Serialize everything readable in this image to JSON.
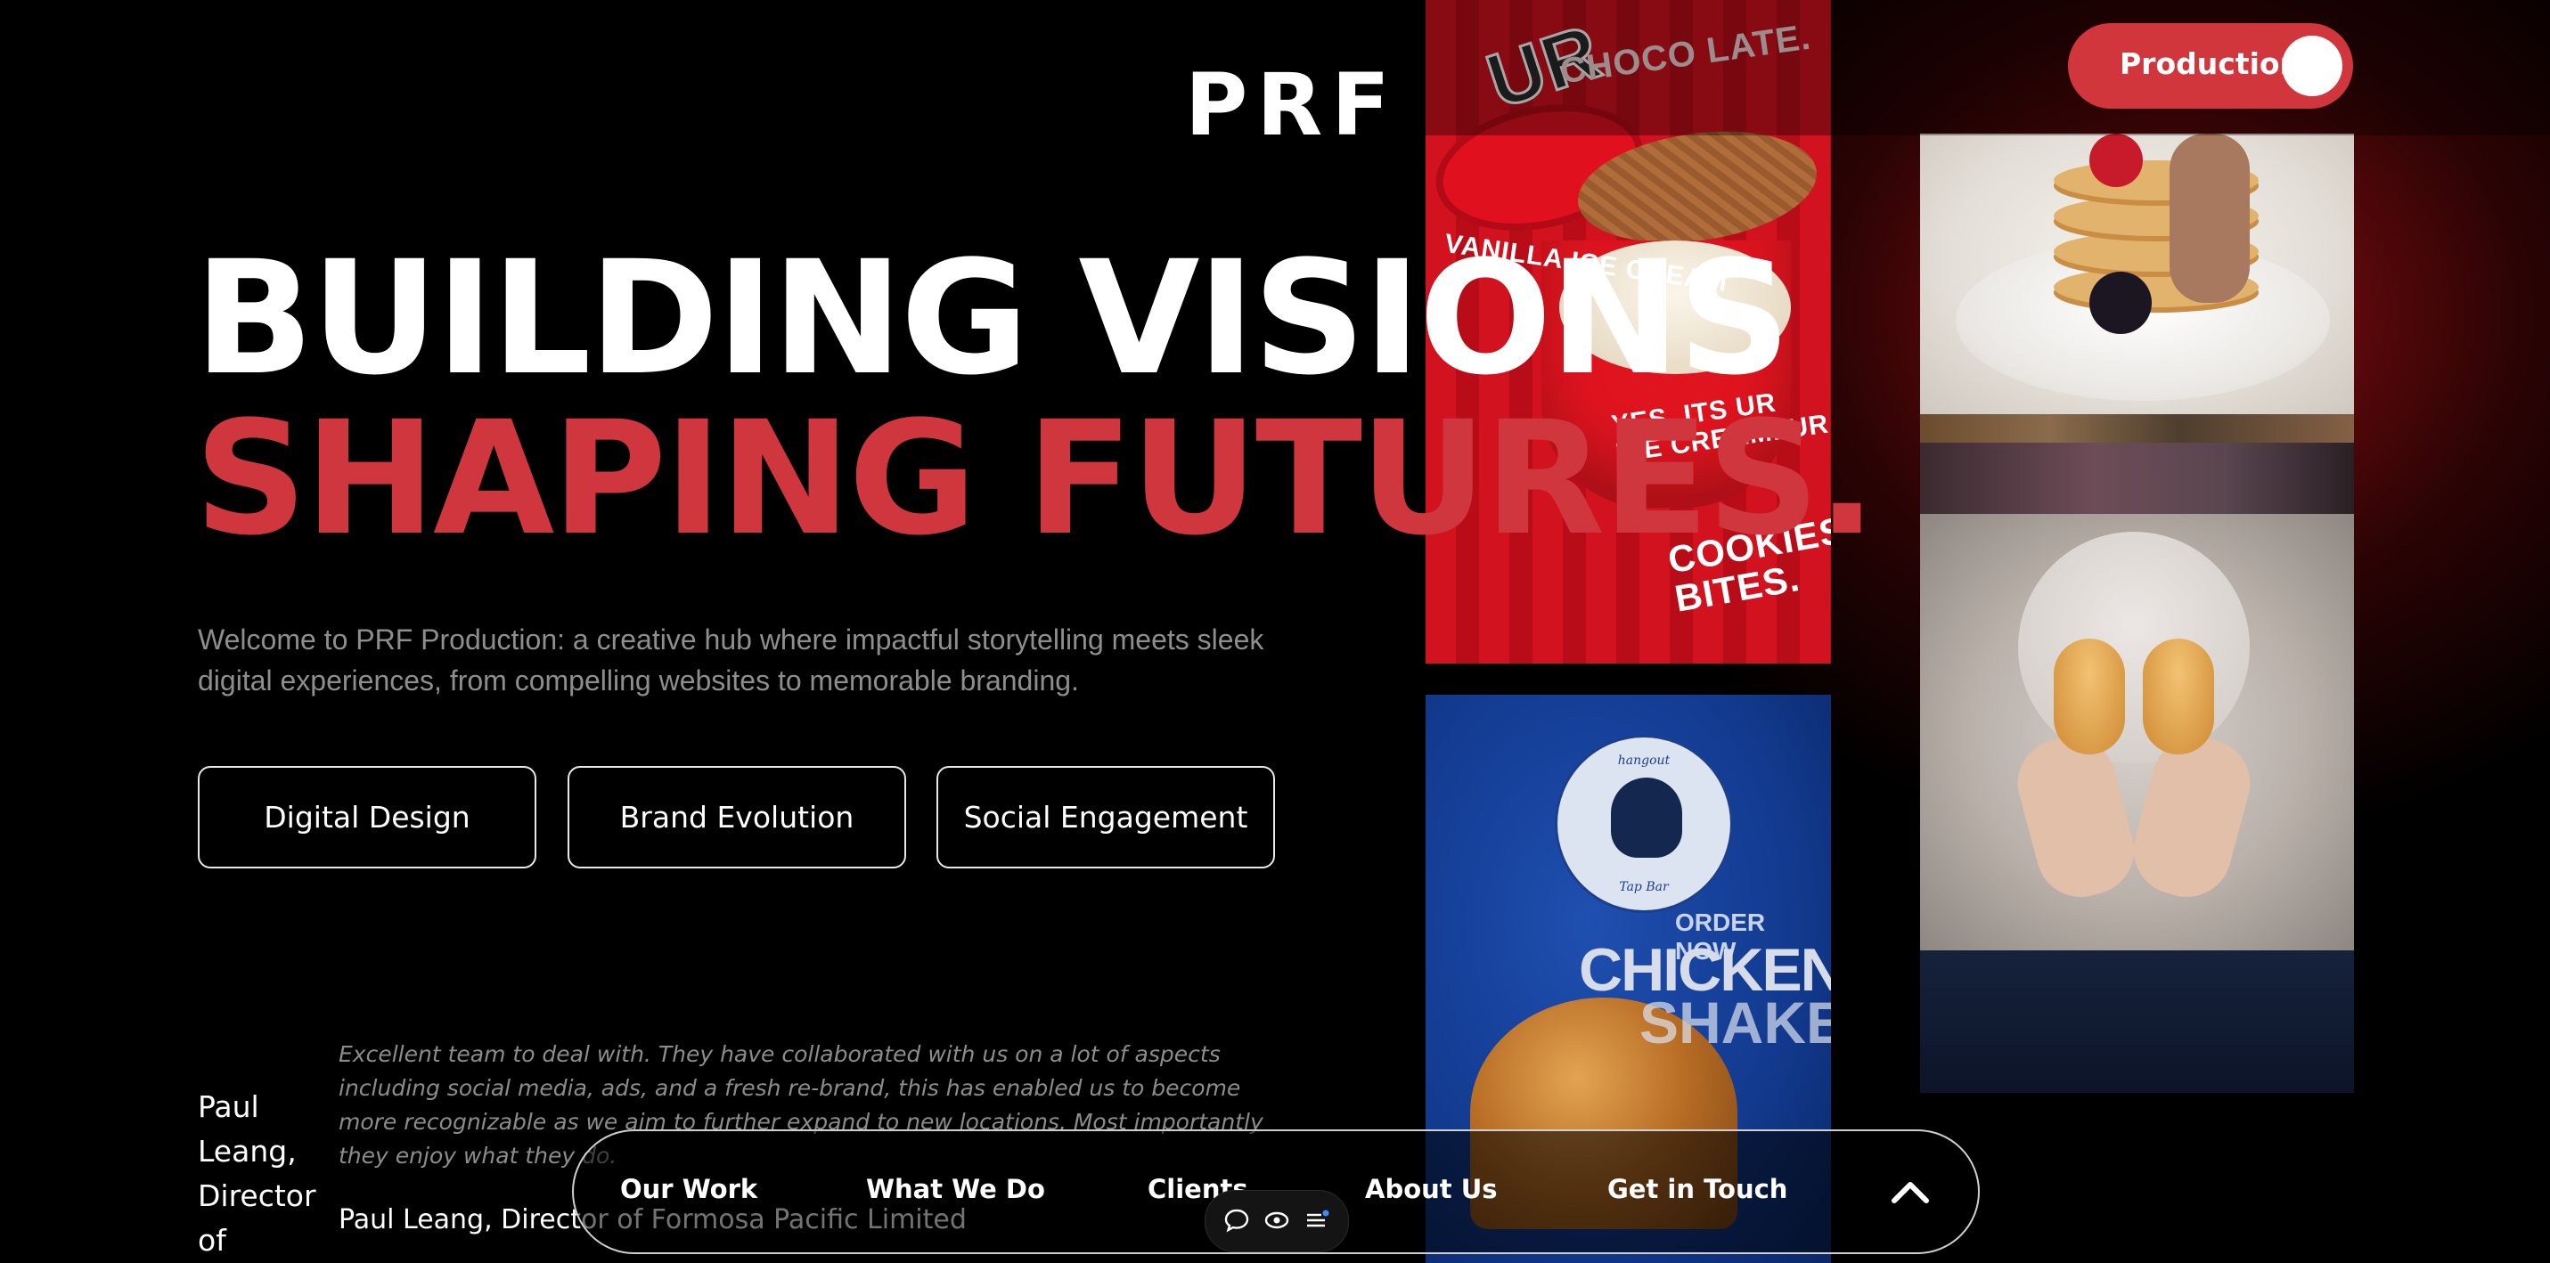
{
  "header": {
    "logo": "PRF",
    "toggle_label": "Production"
  },
  "hero": {
    "line1": "BUILDING VISIONS",
    "line2": "SHAPING FUTURES.",
    "intro": "Welcome to PRF Production: a creative hub where impactful storytelling meets sleek digital experiences, from compelling websites to memorable branding.",
    "services": [
      "Digital Design",
      "Brand Evolution",
      "Social Engagement"
    ]
  },
  "testimonial": {
    "quote": "Excellent team to deal with. They have collaborated with us on a lot of aspects including social media, ads, and a fresh re-brand, this has enabled us to become more recognizable as we aim to further expand to new locations. Most importantly they enjoy what they do.",
    "author_side": "Paul Leang, Director of",
    "author_line": "Paul Leang, Director of Formosa Pacific Limited"
  },
  "collage": {
    "ice_cream": {
      "top_text": "CHOCO LATE.",
      "lid_text": "UR",
      "side_text": "VANILLA ICE CREAM",
      "cup_text": "YES, ITS UR ICE CREAM. UR",
      "cookies_text": "COOKIES BITES."
    },
    "chicken": {
      "badge_top": "hangout",
      "badge_bottom": "Tap Bar",
      "order_now": "ORDER NOW",
      "chicken": "CHICKEN!",
      "shake": "SHAKER"
    }
  },
  "nav": {
    "items": [
      "Our Work",
      "What We Do",
      "Clients",
      "About Us",
      "Get in Touch"
    ]
  },
  "colors": {
    "accent_red": "#d0363e",
    "background": "#000000",
    "muted_text": "#8e8e8e"
  },
  "icons": {
    "toggle_knob": "circle",
    "nav_up": "chevron-up-icon",
    "mini": [
      "chat-bubble-icon",
      "eye-icon",
      "list-icon"
    ]
  }
}
